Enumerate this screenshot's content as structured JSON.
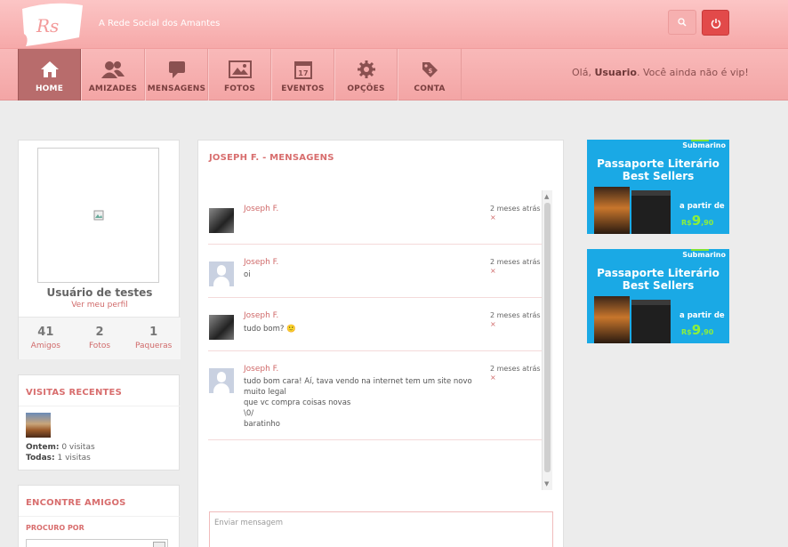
{
  "app": {
    "logo_text": "Rs",
    "tagline": "A Rede Social dos Amantes",
    "greeting_prefix": "Olá, ",
    "greeting_user": "Usuario",
    "greeting_suffix": ". Você ainda não é vip!"
  },
  "nav": {
    "items": [
      {
        "label": "HOME",
        "icon": "home-icon",
        "active": true
      },
      {
        "label": "AMIZADES",
        "icon": "users-icon"
      },
      {
        "label": "MENSAGENS",
        "icon": "chat-icon"
      },
      {
        "label": "FOTOS",
        "icon": "image-icon"
      },
      {
        "label": "EVENTOS",
        "icon": "calendar-icon",
        "calendar_day": "17"
      },
      {
        "label": "OPÇÕES",
        "icon": "gear-icon"
      },
      {
        "label": "CONTA",
        "icon": "tag-icon"
      }
    ]
  },
  "profile": {
    "name": "Usuário de testes",
    "link": "Ver meu perfil",
    "stats": [
      {
        "value": "41",
        "label": "Amigos"
      },
      {
        "value": "2",
        "label": "Fotos"
      },
      {
        "value": "1",
        "label": "Paqueras"
      }
    ]
  },
  "visits": {
    "title": "VISITAS RECENTES",
    "today_label": "Ontem:",
    "today_value": "0 visitas",
    "all_label": "Todas:",
    "all_value": "1 visitas"
  },
  "find_friends": {
    "title": "ENCONTRE AMIGOS",
    "search_label": "PROCURO POR"
  },
  "messages": {
    "title": "JOSEPH F. - MENSAGENS",
    "compose_placeholder": "Enviar mensagem",
    "list": [
      {
        "author": "Joseph F.",
        "lines": [],
        "time": "2 meses atrás",
        "avatar": "photo"
      },
      {
        "author": "Joseph F.",
        "lines": [
          "oi"
        ],
        "time": "2 meses atrás",
        "avatar": "blank"
      },
      {
        "author": "Joseph F.",
        "lines": [
          "tudo bom? 🙂"
        ],
        "time": "2 meses atrás",
        "avatar": "photo"
      },
      {
        "author": "Joseph F.",
        "lines": [
          "tudo bom cara! Aí, tava vendo na internet tem um site novo muito legal",
          "que vc compra coisas novas",
          "\\0/",
          "baratinho"
        ],
        "time": "2 meses atrás",
        "avatar": "blank"
      }
    ],
    "delete_mark": "×"
  },
  "ads": [
    {
      "brand": "Submarino",
      "title_1": "Passaporte Literário",
      "title_2": "Best Sellers",
      "from": "a partir de",
      "currency": "R$",
      "price": "9",
      "cents": ",90"
    },
    {
      "brand": "Submarino",
      "title_1": "Passaporte Literário",
      "title_2": "Best Sellers",
      "from": "a partir de",
      "currency": "R$",
      "price": "9",
      "cents": ",90"
    }
  ]
}
